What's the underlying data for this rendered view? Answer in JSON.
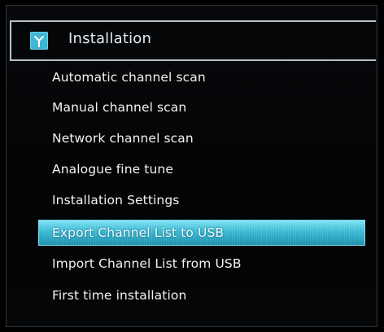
{
  "header": {
    "title": "Installation",
    "icon": "antenna-icon",
    "icon_color": "#3fb6d6"
  },
  "menu": {
    "items": [
      {
        "label": "Automatic channel scan"
      },
      {
        "label": "Manual channel scan"
      },
      {
        "label": "Network channel scan"
      },
      {
        "label": "Analogue fine tune"
      },
      {
        "label": "Installation Settings"
      },
      {
        "label": "Export Channel List to USB"
      },
      {
        "label": "Import Channel List from USB"
      },
      {
        "label": "First time installation"
      }
    ],
    "selected_index": 5,
    "selected_color": "#39b9d3"
  }
}
